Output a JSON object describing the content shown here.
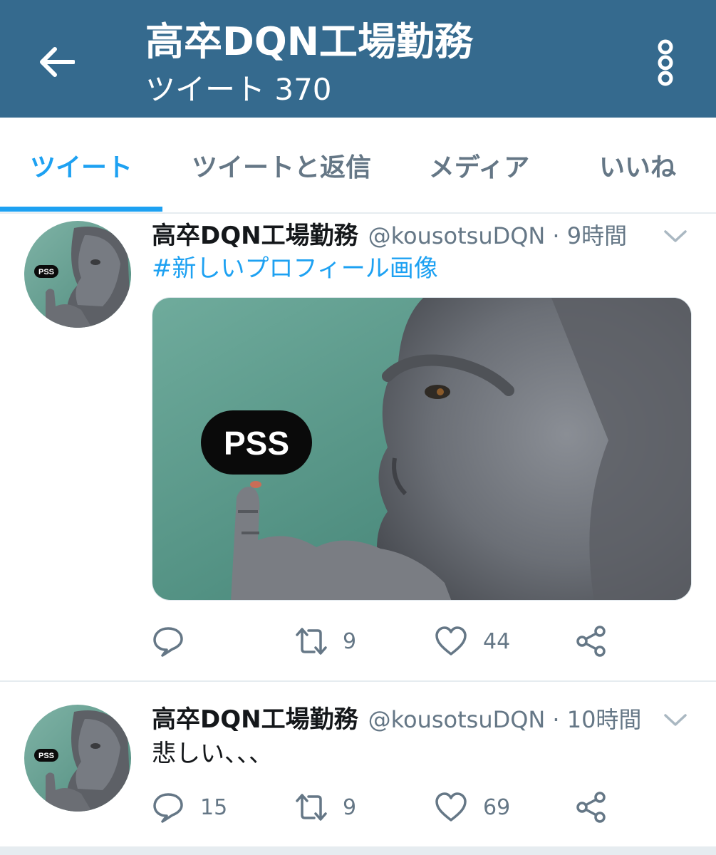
{
  "header": {
    "title": "高卒DQN工場勤務",
    "subtitle": "ツイート 370",
    "back_icon": "arrow-left-icon",
    "more_icon": "more-vertical-icon",
    "bg_color": "#356a8e"
  },
  "tabs": [
    {
      "label": "ツイート",
      "active": true
    },
    {
      "label": "ツイートと返信",
      "active": false
    },
    {
      "label": "メディア",
      "active": false
    },
    {
      "label": "いいね",
      "active": false
    }
  ],
  "accent_color": "#1da1f2",
  "tweets": [
    {
      "name": "高卒DQN工場勤務",
      "handle": "@kousotsuDQN",
      "time": "· 9時間",
      "text": "#新しいプロフィール画像",
      "media": {
        "badge_text": "PSS"
      },
      "avatar_badge": "PSS",
      "actions": {
        "reply": "",
        "retweet": "9",
        "like": "44"
      }
    },
    {
      "name": "高卒DQN工場勤務",
      "handle": "@kousotsuDQN",
      "time": "· 10時間",
      "text": "悲しい、、、",
      "avatar_badge": "PSS",
      "actions": {
        "reply": "15",
        "retweet": "9",
        "like": "69"
      }
    }
  ]
}
